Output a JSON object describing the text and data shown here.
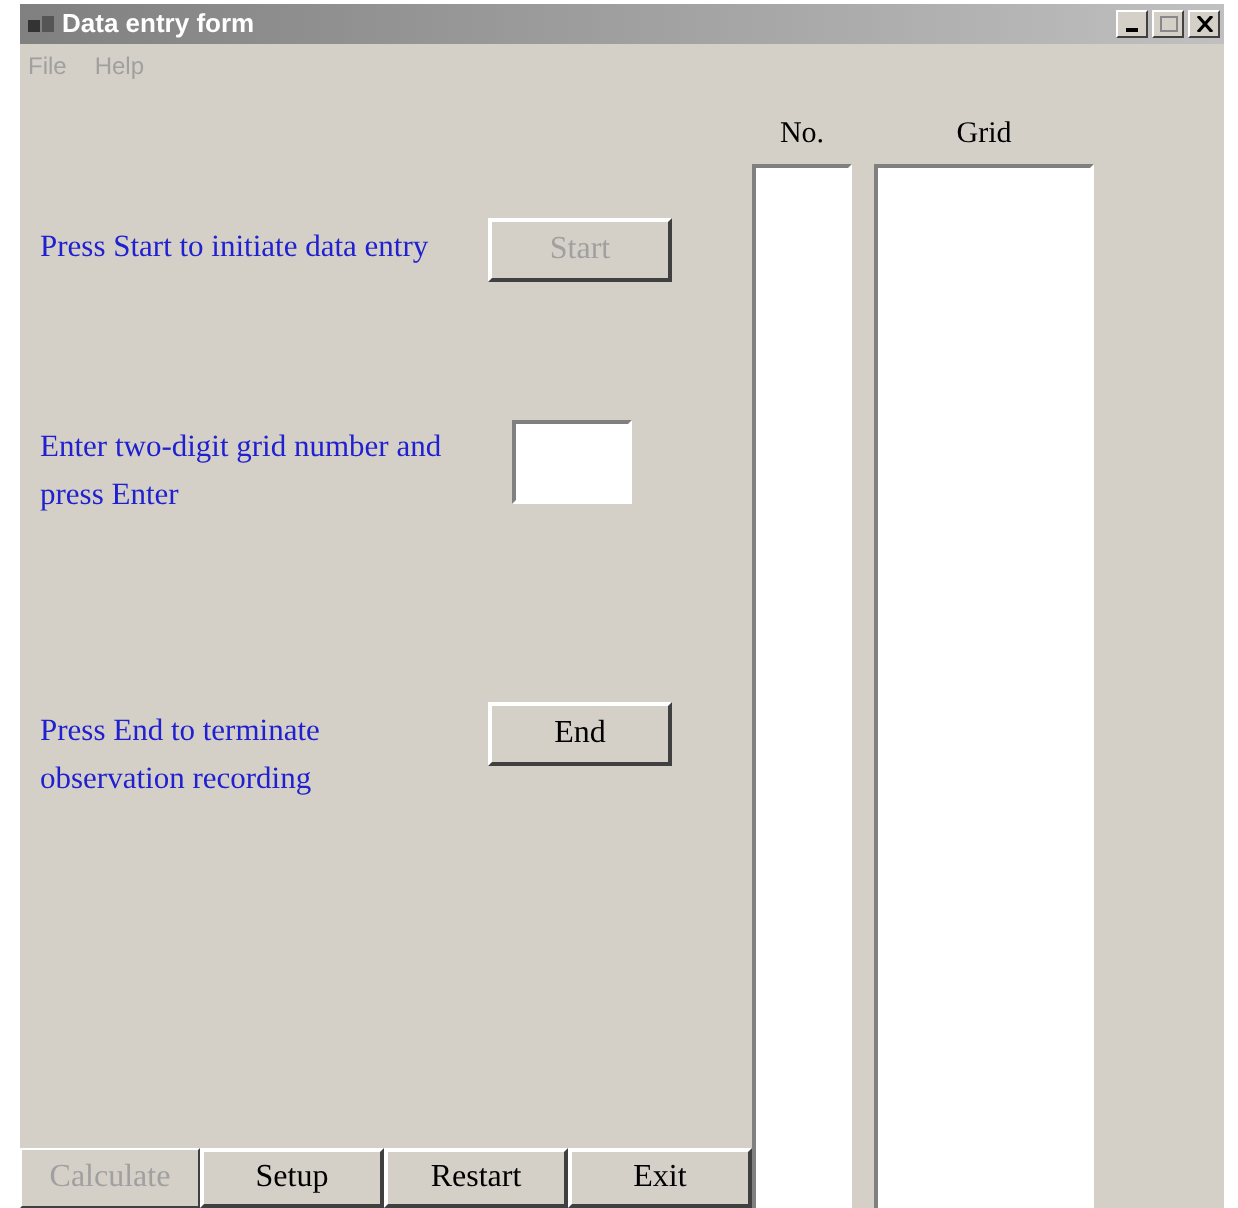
{
  "window": {
    "title": "Data entry form"
  },
  "menu": [
    "File",
    "Help"
  ],
  "steps": [
    {
      "kind": "button",
      "text": "Press Start to initiate data entry",
      "label": "Start",
      "disabled": true
    },
    {
      "kind": "field",
      "text": "Enter two-digit grid number and press Enter"
    },
    {
      "kind": "button",
      "text": "Press End to terminate observation recording",
      "label": "End",
      "disabled": false
    }
  ],
  "lists": [
    {
      "heading": "No."
    },
    {
      "heading": "Grid"
    }
  ],
  "buttons": [
    {
      "label": "Calculate",
      "disabled": true
    },
    {
      "label": "Setup",
      "disabled": false
    },
    {
      "label": "Restart",
      "disabled": false
    },
    {
      "label": "Exit",
      "disabled": false
    }
  ]
}
